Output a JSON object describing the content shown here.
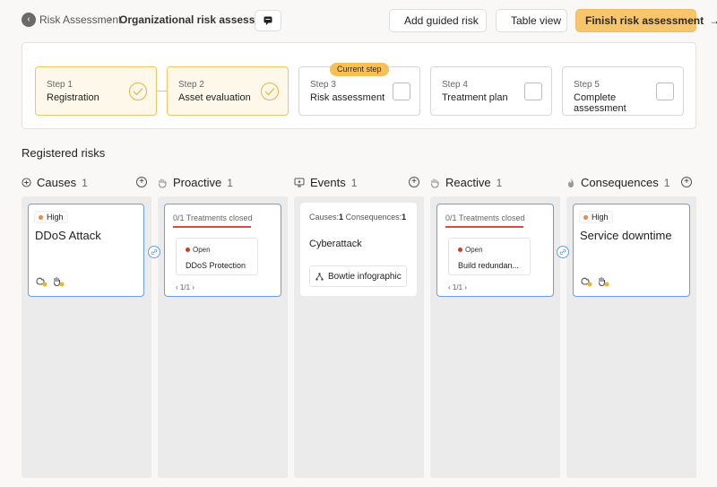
{
  "header": {
    "breadcrumb_parent": "Risk Assessment",
    "breadcrumb_sep": "›",
    "breadcrumb_current": "Organizational risk assessment",
    "add_guided_label": "Add guided risk",
    "table_view_label": "Table view",
    "finish_label": "Finish risk assessment",
    "finish_arrow": "→"
  },
  "steps": {
    "current_badge": "Current step",
    "items": [
      {
        "num": "Step 1",
        "name": "Registration",
        "status": "done"
      },
      {
        "num": "Step 2",
        "name": "Asset evaluation",
        "status": "done"
      },
      {
        "num": "Step 3",
        "name": "Risk assessment",
        "status": "current"
      },
      {
        "num": "Step 4",
        "name": "Treatment plan",
        "status": "todo"
      },
      {
        "num": "Step 5",
        "name": "Complete assessment",
        "status": "todo"
      }
    ]
  },
  "board": {
    "section_title": "Registered risks",
    "columns": [
      {
        "name": "Causes",
        "count": "1",
        "icon": "plus-circle-icon"
      },
      {
        "name": "Proactive",
        "count": "1",
        "icon": "hand-icon"
      },
      {
        "name": "Events",
        "count": "1",
        "icon": "monitor-icon"
      },
      {
        "name": "Reactive",
        "count": "1",
        "icon": "hand-icon"
      },
      {
        "name": "Consequences",
        "count": "1",
        "icon": "flame-icon"
      }
    ],
    "cause_card": {
      "level": "High",
      "title": "DDoS Attack"
    },
    "proactive_card": {
      "treatments": "0/1 Treatments closed",
      "status": "Open",
      "title": "DDoS Protection",
      "pager": "1/1"
    },
    "event_card": {
      "causes_label": "Causes:",
      "causes_count": "1",
      "cons_label": "Consequences:",
      "cons_count": "1",
      "title": "Cyberattack",
      "bowtie_label": "Bowtie infographic"
    },
    "reactive_card": {
      "treatments": "0/1 Treatments closed",
      "status": "Open",
      "title": "Build redundan...",
      "pager": "1/1"
    },
    "consequence_card": {
      "level": "High",
      "title": "Service downtime"
    }
  },
  "colors": {
    "accent": "#f6c56c",
    "link": "#6a9fdc",
    "high": "#f08a3a",
    "open": "#d9352b"
  }
}
